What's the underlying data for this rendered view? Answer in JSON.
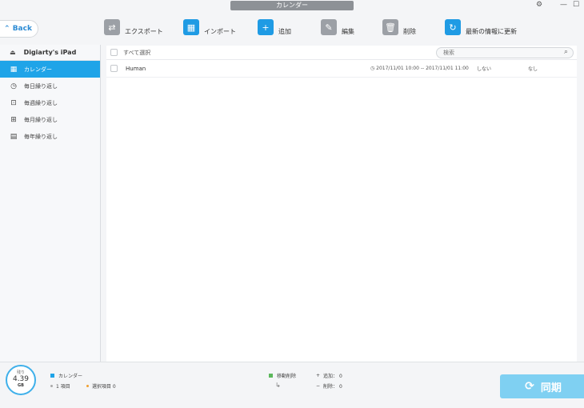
{
  "window": {
    "title": "カレンダー"
  },
  "toolbar": {
    "back_label": "Back",
    "export_label": "エクスポート",
    "import_label": "インポート",
    "add_label": "追加",
    "edit_label": "編集",
    "delete_label": "削除",
    "refresh_label": "最新の情報に更新"
  },
  "sidebar": {
    "device": "Digiarty's iPad",
    "items": [
      {
        "label": "カレンダー",
        "icon": "calendar-icon"
      },
      {
        "label": "毎日繰り返し",
        "icon": "clock-icon"
      },
      {
        "label": "毎週繰り返し",
        "icon": "calendar-7-icon"
      },
      {
        "label": "毎月繰り返し",
        "icon": "calendar-31-icon"
      },
      {
        "label": "毎年繰り返し",
        "icon": "calendar-year-icon"
      }
    ]
  },
  "list": {
    "select_all": "すべて選択",
    "search_placeholder": "検索",
    "rows": [
      {
        "name": "Human",
        "time": "2017/11/01 10:00 -- 2017/11/01 11:00",
        "repeat": "しない",
        "alert": "なし"
      }
    ]
  },
  "footer": {
    "storage_label": "残り",
    "storage_value": "4.39",
    "storage_unit": "GB",
    "category_label": "カレンダー",
    "items_count": "1 項目",
    "selected_items": "選択項目 0",
    "pending_delete_label": "移動削除",
    "add_count": "追加： 0",
    "delete_count": "削除： 0",
    "sync_label": "同期"
  },
  "colors": {
    "accent": "#1fa4e8",
    "sync_button": "#7fd0f2",
    "pending_green": "#5cb85c",
    "selected_orange": "#f0a030"
  }
}
